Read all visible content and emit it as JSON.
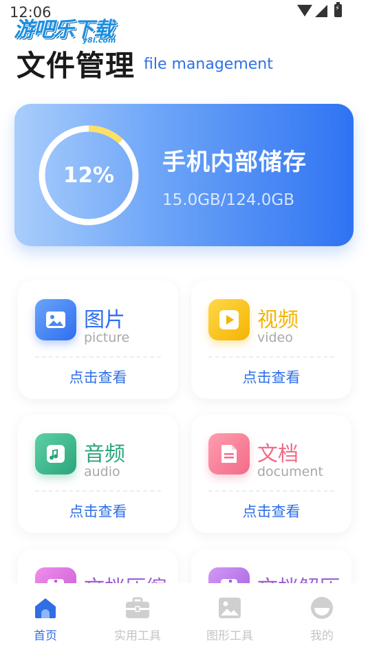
{
  "status_bar": {
    "time": "12:06"
  },
  "watermark": {
    "text": "游吧乐下载",
    "domain": "y8l.com"
  },
  "header": {
    "title": "文件管理",
    "subtitle": "file management"
  },
  "storage": {
    "percent_label": "12%",
    "used_fraction": 0.12,
    "title": "手机内部储存",
    "usage": "15.0GB/124.0GB",
    "ring_color": "#ffe066",
    "ring_track_color": "#ffffff"
  },
  "categories": [
    {
      "name": "图片",
      "en": "picture",
      "link": "点击查看",
      "icon": "image-icon",
      "color": "#2f6ef0"
    },
    {
      "name": "视频",
      "en": "video",
      "link": "点击查看",
      "icon": "play-icon",
      "color": "#f5b400"
    },
    {
      "name": "音频",
      "en": "audio",
      "link": "点击查看",
      "icon": "music-note-icon",
      "color": "#2aa57a"
    },
    {
      "name": "文档",
      "en": "document",
      "link": "点击查看",
      "icon": "file-icon",
      "color": "#f26b87"
    },
    {
      "name": "文档压缩",
      "icon": "zip-icon",
      "color": "#9b5fd0"
    },
    {
      "name": "文档解压",
      "icon": "unzip-icon",
      "color": "#9b5fd0"
    }
  ],
  "bottom_nav": [
    {
      "label": "首页",
      "icon": "home-icon",
      "active": true
    },
    {
      "label": "实用工具",
      "icon": "toolbox-icon",
      "active": false
    },
    {
      "label": "图形工具",
      "icon": "image-icon",
      "active": false
    },
    {
      "label": "我的",
      "icon": "profile-icon",
      "active": false
    }
  ],
  "accent_color": "#2f6fe6"
}
